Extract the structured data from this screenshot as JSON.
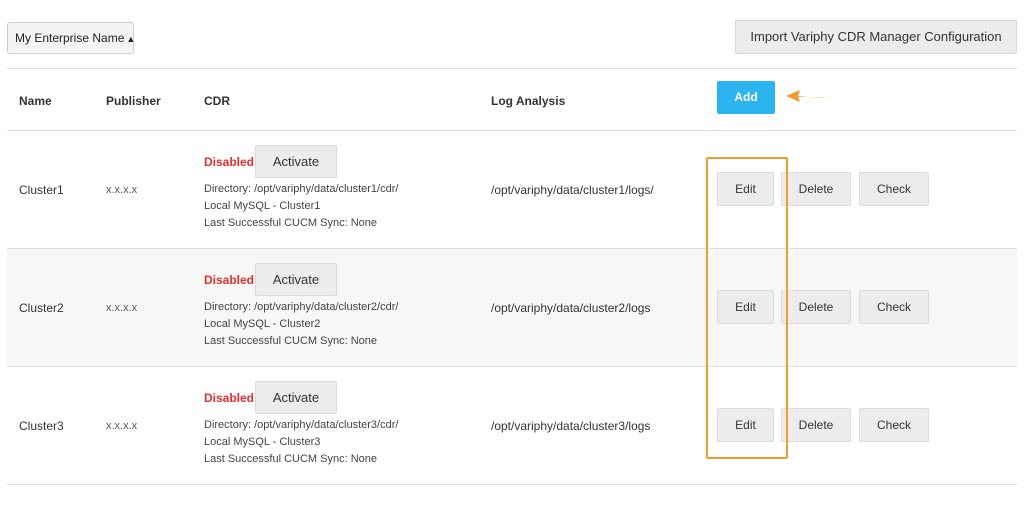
{
  "toolbar": {
    "enterprise_select": "My Enterprise Name",
    "import_button": "Import Variphy CDR Manager Configuration"
  },
  "table": {
    "headers": {
      "name": "Name",
      "publisher": "Publisher",
      "cdr": "CDR",
      "log_analysis": "Log Analysis"
    },
    "add_button": "Add",
    "rows": [
      {
        "name": "Cluster1",
        "publisher": "x.x.x.x",
        "status": "Disabled",
        "activate": "Activate",
        "directory": "Directory: /opt/variphy/data/cluster1/cdr/",
        "mysql": "Local MySQL - Cluster1",
        "last_sync": "Last Successful CUCM Sync:  None",
        "log_path": "/opt/variphy/data/cluster1/logs/",
        "edit": "Edit",
        "delete": "Delete",
        "check": "Check"
      },
      {
        "name": "Cluster2",
        "publisher": "x.x.x.x",
        "status": "Disabled",
        "activate": "Activate",
        "directory": "Directory: /opt/variphy/data/cluster2/cdr/",
        "mysql": "Local MySQL - Cluster2",
        "last_sync": "Last Successful CUCM Sync:  None",
        "log_path": "/opt/variphy/data/cluster2/logs",
        "edit": "Edit",
        "delete": "Delete",
        "check": "Check"
      },
      {
        "name": "Cluster3",
        "publisher": "x.x.x.x",
        "status": "Disabled",
        "activate": "Activate",
        "directory": "Directory: /opt/variphy/data/cluster3/cdr/",
        "mysql": "Local MySQL - Cluster3",
        "last_sync": "Last Successful CUCM Sync:  None",
        "log_path": "/opt/variphy/data/cluster3/logs",
        "edit": "Edit",
        "delete": "Delete",
        "check": "Check"
      }
    ]
  },
  "annotations": {
    "highlight_color": "#f39c2b",
    "add_button_color": "#2cb4f0",
    "disabled_color": "#e0302b"
  }
}
